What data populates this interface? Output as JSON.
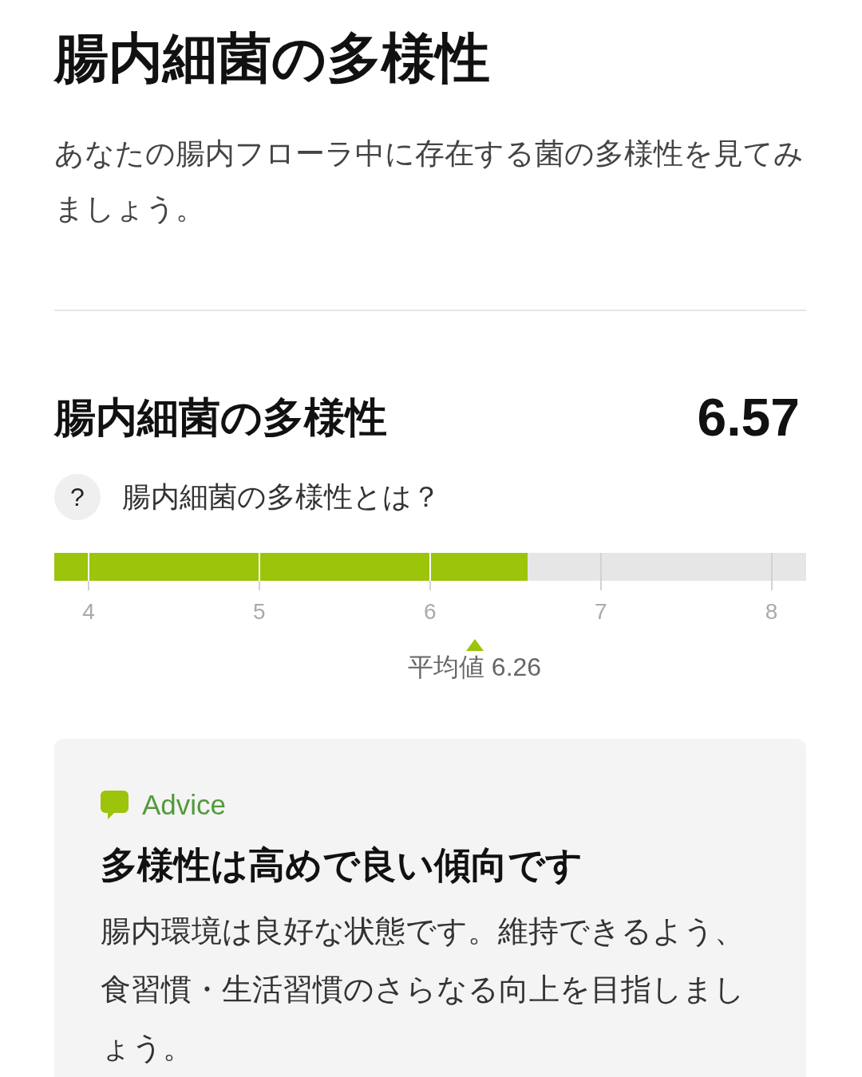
{
  "header": {
    "title": "腸内細菌の多様性",
    "description": "あなたの腸内フローラ中に存在する菌の多様性を見てみましょう。"
  },
  "score": {
    "title": "腸内細菌の多様性",
    "value": "6.57"
  },
  "help": {
    "icon": "?",
    "label": "腸内細菌の多様性とは？"
  },
  "gauge": {
    "level": 0.63,
    "ticks": [
      "4",
      "5",
      "6",
      "7",
      "8"
    ],
    "average": {
      "level": 0.559,
      "label": "平均値 6.26"
    }
  },
  "advice": {
    "label": "Advice",
    "heading": "多様性は高めで良い傾向です",
    "text": "腸内環境は良好な状態です。維持できるよう、食習慣・生活習慣のさらなる向上を目指しましょう。"
  }
}
